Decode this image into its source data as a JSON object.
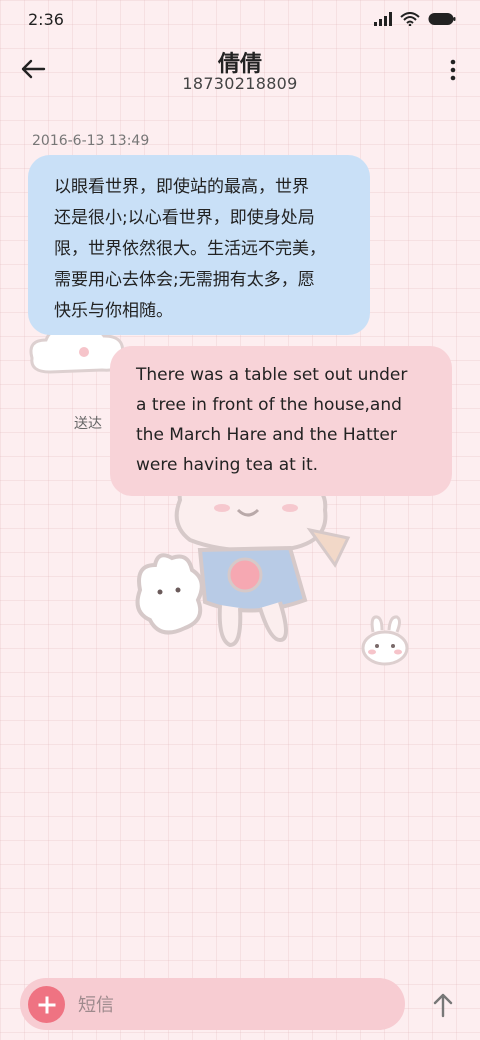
{
  "status_bar": {
    "time": "2:36",
    "icons": [
      "signal-icon",
      "wifi-icon",
      "battery-icon"
    ]
  },
  "header": {
    "contact_name": "倩倩",
    "phone_number": "18730218809",
    "back_icon": "back-arrow-icon",
    "menu_icon": "more-vertical-icon"
  },
  "conversation": {
    "timestamp": "2016-6-13 13:49",
    "messages": [
      {
        "direction": "incoming",
        "lines": [
          "以眼看世界，即使站的最高，世界",
          "还是很小;以心看世界，即使身处局",
          "限，世界依然很大。生活远不完美，",
          "需要用心去体会;无需拥有太多，愿",
          "快乐与你相随。"
        ]
      },
      {
        "direction": "outgoing",
        "lines": [
          "There was a table set out under",
          "a tree in front of the house,and",
          "the March Hare and the Hatter",
          "were having tea at it."
        ],
        "status": "送达"
      }
    ]
  },
  "composer": {
    "placeholder": "短信",
    "add_icon": "plus-icon",
    "send_icon": "send-arrow-up-icon"
  },
  "colors": {
    "background": "#fdeef0",
    "incoming_bubble": "#c9e0f7",
    "outgoing_bubble": "#f8d3d8",
    "accent": "#ef7382",
    "input_bar": "#f7ccd2"
  }
}
